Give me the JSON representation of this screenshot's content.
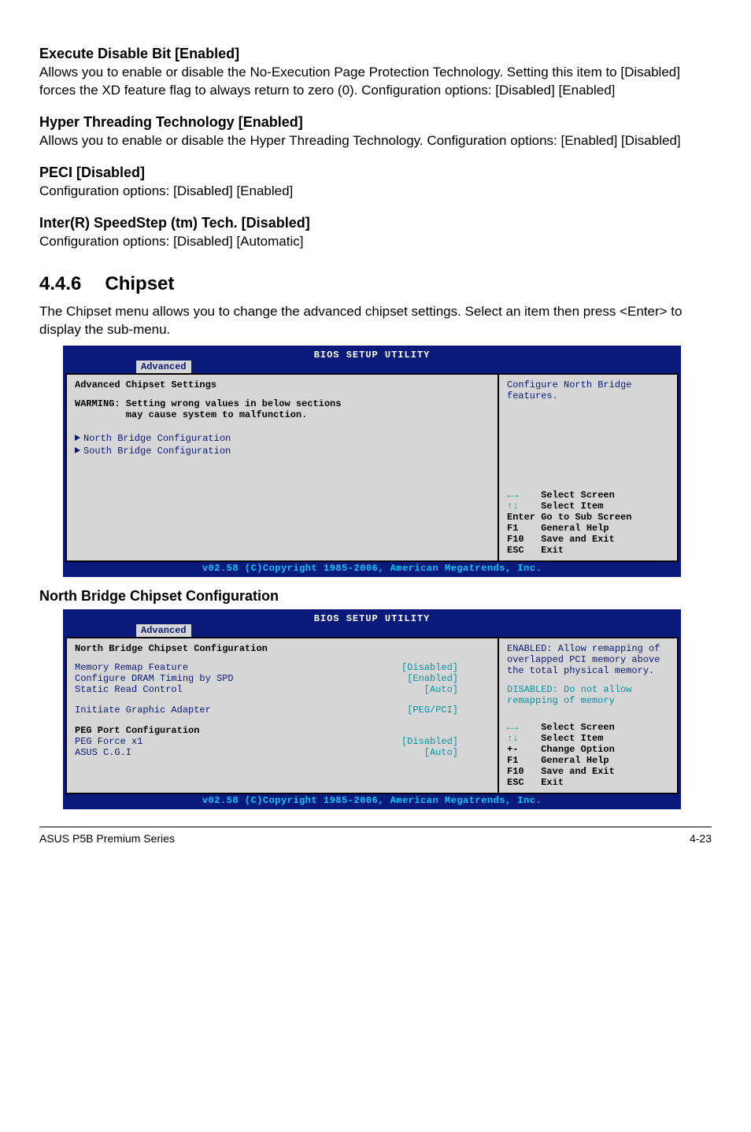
{
  "sections": {
    "execute_disable": {
      "heading": "Execute Disable Bit [Enabled]",
      "body": "Allows you to enable or disable the No-Execution Page Protection Technology. Setting this item to [Disabled] forces the XD feature flag to always return to zero (0). Configuration options: [Disabled] [Enabled]"
    },
    "hyper_threading": {
      "heading": "Hyper Threading Technology [Enabled]",
      "body": "Allows you to enable or disable the Hyper Threading Technology. Configuration options: [Enabled] [Disabled]"
    },
    "peci": {
      "heading": "PECI [Disabled]",
      "body": "Configuration options: [Disabled] [Enabled]"
    },
    "speedstep": {
      "heading": "Inter(R) SpeedStep (tm) Tech. [Disabled]",
      "body": "Configuration options: [Disabled] [Automatic]"
    },
    "chipset": {
      "number": "4.4.6",
      "title": "Chipset",
      "intro": "The Chipset menu allows you to change the advanced chipset settings. Select an item then press <Enter> to display the sub-menu."
    },
    "north_bridge_heading": "North Bridge Chipset Configuration"
  },
  "bios1": {
    "header": "BIOS SETUP UTILITY",
    "tab": "Advanced",
    "title": "Advanced Chipset Settings",
    "warning": "WARMING: Setting wrong values in below sections\n         may cause system to malfunction.",
    "links": [
      "North Bridge Configuration",
      "South Bridge Configuration"
    ],
    "help": "Configure North Bridge features.",
    "nav": [
      {
        "key": "←→",
        "label": "Select Screen"
      },
      {
        "key": "↑↓",
        "label": "Select Item"
      },
      {
        "key": "Enter",
        "label": "Go to Sub Screen"
      },
      {
        "key": "F1",
        "label": "General Help"
      },
      {
        "key": "F10",
        "label": "Save and Exit"
      },
      {
        "key": "ESC",
        "label": "Exit"
      }
    ],
    "footer": "v02.58 (C)Copyright 1985-2006, American Megatrends, Inc."
  },
  "bios2": {
    "header": "BIOS SETUP UTILITY",
    "tab": "Advanced",
    "title": "North Bridge Chipset Configuration",
    "rows": [
      {
        "k": "Memory Remap Feature",
        "v": "[Disabled]"
      },
      {
        "k": "Configure DRAM Timing by SPD",
        "v": "[Enabled]"
      },
      {
        "k": "Static Read Control",
        "v": "[Auto]"
      },
      {
        "k": "",
        "v": ""
      },
      {
        "k": "Initiate Graphic Adapter",
        "v": "[PEG/PCI]"
      },
      {
        "k": "",
        "v": ""
      }
    ],
    "subhead": "PEG Port Configuration",
    "rows2": [
      {
        "k": "PEG Force x1",
        "v": "[Disabled]"
      },
      {
        "k": "ASUS C.G.I",
        "v": "[Auto]"
      }
    ],
    "help_en": "ENABLED: Allow remapping of overlapped PCI memory above the total physical memory.",
    "help_dis": "DISABLED: Do not allow remapping of memory",
    "nav": [
      {
        "key": "←→",
        "label": "Select Screen"
      },
      {
        "key": "↑↓",
        "label": "Select Item"
      },
      {
        "key": "+-",
        "label": "Change Option"
      },
      {
        "key": "F1",
        "label": "General Help"
      },
      {
        "key": "F10",
        "label": "Save and Exit"
      },
      {
        "key": "ESC",
        "label": "Exit"
      }
    ],
    "footer": "v02.58 (C)Copyright 1985-2006, American Megatrends, Inc."
  },
  "footer": {
    "left": "ASUS P5B Premium Series",
    "right": "4-23"
  }
}
